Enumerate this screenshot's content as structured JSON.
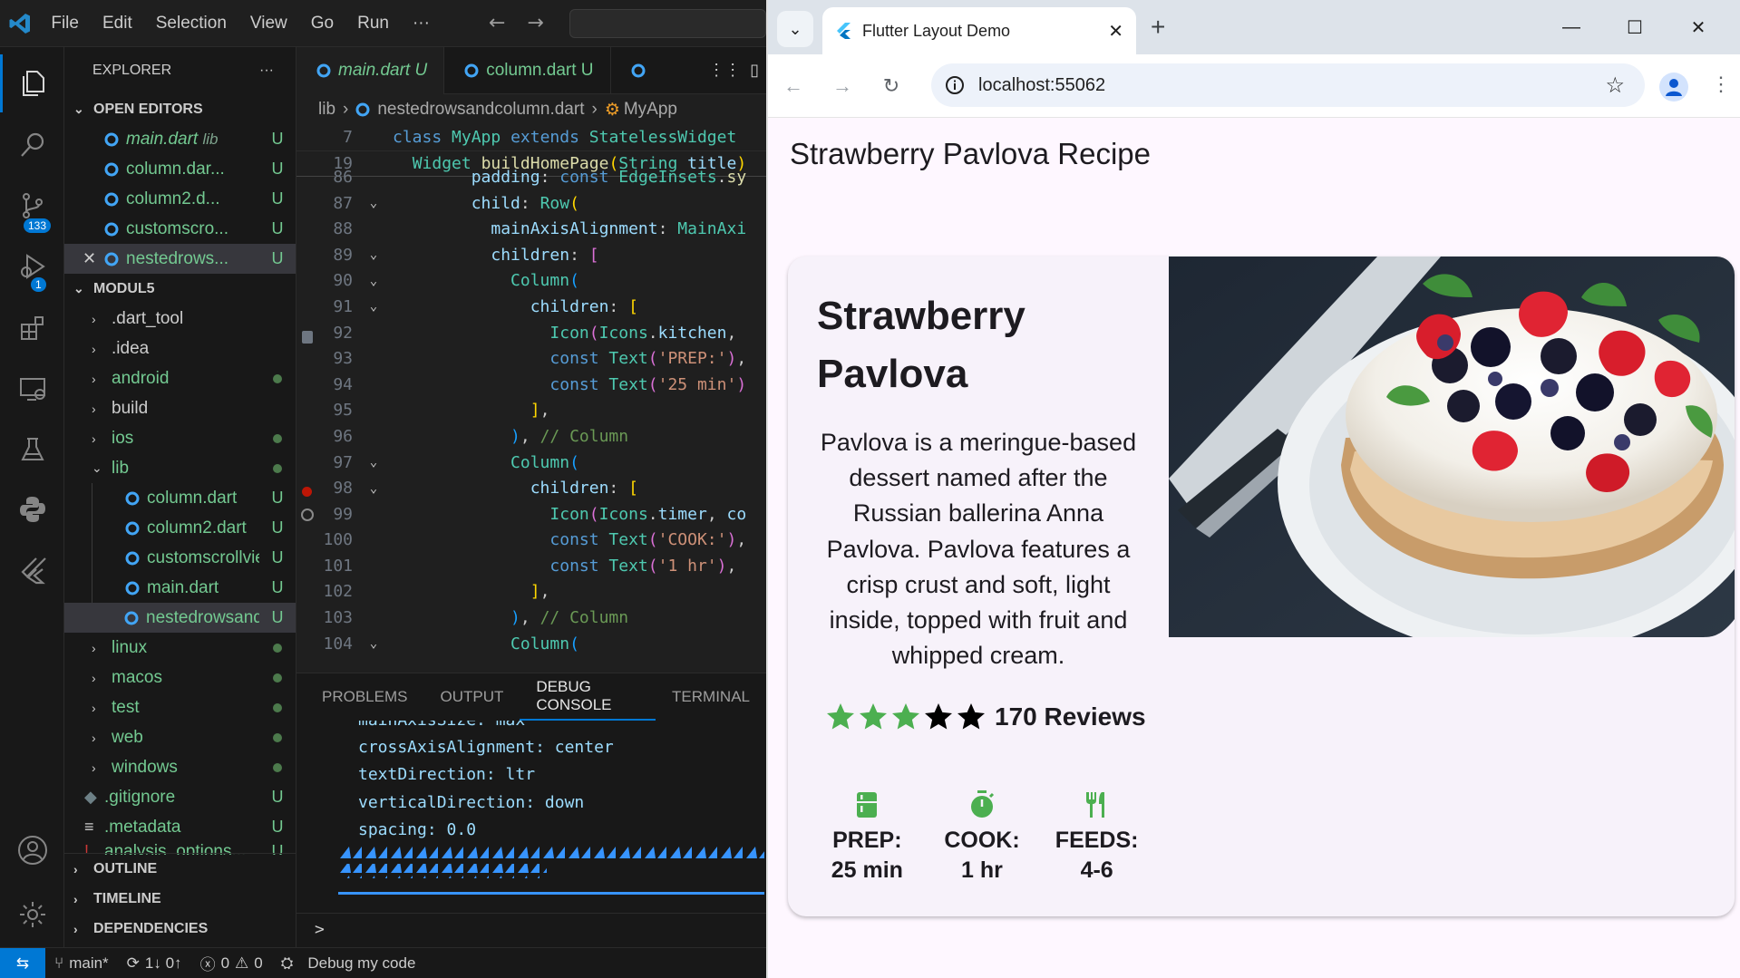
{
  "vscode": {
    "menu": [
      "File",
      "Edit",
      "Selection",
      "View",
      "Go",
      "Run",
      "···"
    ],
    "activity_badges": {
      "source_control": "133",
      "debug": "1"
    },
    "explorer": {
      "title": "EXPLORER",
      "more": "···",
      "open_editors_label": "OPEN EDITORS",
      "open_editors": [
        {
          "name": "main.dart",
          "suffix": "lib",
          "status": "U"
        },
        {
          "name": "column.dar...",
          "status": "U"
        },
        {
          "name": "column2.d...",
          "status": "U"
        },
        {
          "name": "customscro...",
          "status": "U"
        },
        {
          "name": "nestedrows...",
          "status": "U"
        }
      ],
      "workspace_label": "MODUL5",
      "tree": [
        {
          "name": ".dart_tool",
          "status": ""
        },
        {
          "name": ".idea",
          "status": ""
        },
        {
          "name": "android",
          "status": "dot"
        },
        {
          "name": "build",
          "status": ""
        },
        {
          "name": "ios",
          "status": "dot"
        },
        {
          "name": "lib",
          "status": "dot"
        },
        {
          "name": "column.dart",
          "status": "U"
        },
        {
          "name": "column2.dart",
          "status": "U"
        },
        {
          "name": "customscrollvie...",
          "status": "U"
        },
        {
          "name": "main.dart",
          "status": "U"
        },
        {
          "name": "nestedrowsand...",
          "status": "U"
        },
        {
          "name": "linux",
          "status": "dot"
        },
        {
          "name": "macos",
          "status": "dot"
        },
        {
          "name": "test",
          "status": "dot"
        },
        {
          "name": "web",
          "status": "dot"
        },
        {
          "name": "windows",
          "status": "dot"
        },
        {
          "name": ".gitignore",
          "status": "U"
        },
        {
          "name": ".metadata",
          "status": "U"
        },
        {
          "name": "analysis_options...",
          "status": "U"
        }
      ],
      "bottom_sections": [
        "OUTLINE",
        "TIMELINE",
        "DEPENDENCIES"
      ]
    },
    "editor_tabs": [
      {
        "name": "main.dart",
        "status": "U"
      },
      {
        "name": "column.dart",
        "status": "U"
      }
    ],
    "breadcrumb": {
      "folder": "lib",
      "file": "nestedrowsandcolumn.dart",
      "symbol": "MyApp"
    },
    "sticky_lines": [
      {
        "ln": "7",
        "text": "class MyApp extends StatelessWidget"
      },
      {
        "ln": "19",
        "text": "  Widget buildHomePage(String title)"
      }
    ],
    "code_lines": [
      {
        "ln": "86",
        "text": "        padding: const EdgeInsets.sy"
      },
      {
        "ln": "87",
        "text": "        child: Row("
      },
      {
        "ln": "88",
        "text": "          mainAxisAlignment: MainAxi"
      },
      {
        "ln": "89",
        "text": "          children: ["
      },
      {
        "ln": "90",
        "text": "            Column("
      },
      {
        "ln": "91",
        "text": "              children: ["
      },
      {
        "ln": "92",
        "text": "                Icon(Icons.kitchen,"
      },
      {
        "ln": "93",
        "text": "                const Text('PREP:'),"
      },
      {
        "ln": "94",
        "text": "                const Text('25 min')"
      },
      {
        "ln": "95",
        "text": "              ],"
      },
      {
        "ln": "96",
        "text": "            ), // Column"
      },
      {
        "ln": "97",
        "text": "            Column("
      },
      {
        "ln": "98",
        "text": "              children: ["
      },
      {
        "ln": "99",
        "text": "                Icon(Icons.timer, co"
      },
      {
        "ln": "100",
        "text": "                const Text('COOK:'),"
      },
      {
        "ln": "101",
        "text": "                const Text('1 hr'),"
      },
      {
        "ln": "102",
        "text": "              ],"
      },
      {
        "ln": "103",
        "text": "            ), // Column"
      },
      {
        "ln": "104",
        "text": "            Column("
      }
    ],
    "panel_tabs": [
      "PROBLEMS",
      "OUTPUT",
      "DEBUG CONSOLE",
      "TERMINAL"
    ],
    "console_lines": [
      "mainAxisSize: max",
      "crossAxisAlignment: center",
      "textDirection: ltr",
      "verticalDirection: down",
      "spacing: 0.0"
    ],
    "console_prompt": ">",
    "status": {
      "branch": "main*",
      "sync": "1↓ 0↑",
      "errors": "0",
      "warnings": "0",
      "debug": "Debug my code"
    }
  },
  "browser": {
    "tab_title": "Flutter Layout Demo",
    "url": "localhost:55062",
    "app_title": "Strawberry Pavlova Recipe",
    "recipe": {
      "title": "Strawberry Pavlova",
      "description": "Pavlova is a meringue-based dessert named after the Russian ballerina Anna Pavlova. Pavlova features a crisp crust and soft, light inside, topped with fruit and whipped cream.",
      "stars_filled": 3,
      "stars_total": 5,
      "reviews": "170 Reviews",
      "info": [
        {
          "icon": "kitchen-icon",
          "label": "PREP:",
          "value": "25 min"
        },
        {
          "icon": "timer-icon",
          "label": "COOK:",
          "value": "1 hr"
        },
        {
          "icon": "restaurant-icon",
          "label": "FEEDS:",
          "value": "4-6"
        }
      ]
    },
    "colors": {
      "accent_green": "#4caf50",
      "star_empty": "#000000",
      "page_bg": "#fef7ff",
      "card_bg": "#f7f2fa"
    }
  }
}
